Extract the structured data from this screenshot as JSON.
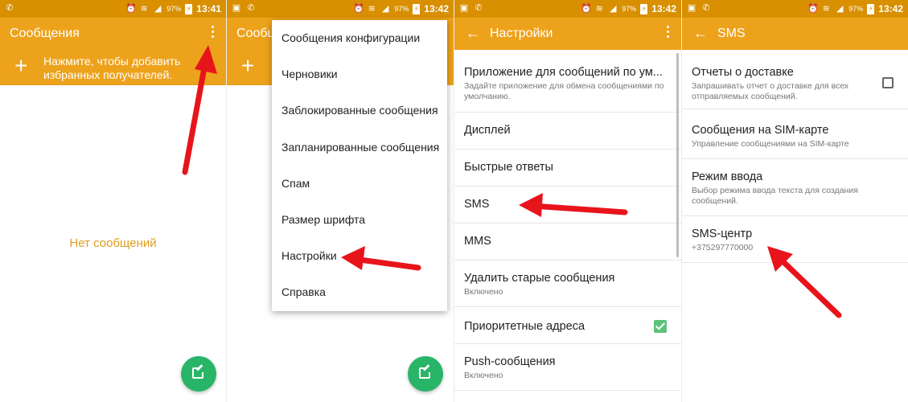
{
  "status": {
    "panel1_time": "13:41",
    "panel2_time": "13:42",
    "panel3_time": "13:42",
    "panel4_time": "13:42",
    "battery": "97%"
  },
  "panel1": {
    "title": "Сообщения",
    "favorites_text": "Нажмите, чтобы добавить избранных получателей.",
    "empty_text": "Нет сообщений"
  },
  "panel2": {
    "title": "Сообщ",
    "menu": [
      {
        "label": "Сообщения конфигурации"
      },
      {
        "label": "Черновики"
      },
      {
        "label": "Заблокированные сообщения"
      },
      {
        "label": "Запланированные сообщения"
      },
      {
        "label": "Спам"
      },
      {
        "label": "Размер шрифта"
      },
      {
        "label": "Настройки"
      },
      {
        "label": "Справка"
      }
    ]
  },
  "panel3": {
    "title": "Настройки",
    "items": [
      {
        "title": "Приложение для сообщений по ум...",
        "subtitle": "Задайте приложение для обмена сообщениями по умолчанию."
      },
      {
        "title": "Дисплей"
      },
      {
        "title": "Быстрые ответы"
      },
      {
        "title": "SMS"
      },
      {
        "title": "MMS"
      },
      {
        "title": "Удалить старые сообщения",
        "subtitle": "Включено"
      },
      {
        "title": "Приоритетные адреса",
        "checked": true
      },
      {
        "title": "Push-сообщения",
        "subtitle": "Включено"
      }
    ]
  },
  "panel4": {
    "title": "SMS",
    "items": [
      {
        "title": "Отчеты о доставке",
        "subtitle": "Запрашивать отчет о доставке для всех отправляемых сообщений.",
        "checked": false
      },
      {
        "title": "Сообщения на SIM-карте",
        "subtitle": "Управление сообщениями на SIM-карте"
      },
      {
        "title": "Режим ввода",
        "subtitle": "Выбор режима ввода текста для создания сообщений."
      },
      {
        "title": "SMS-центр",
        "subtitle": "+375297770000"
      }
    ]
  },
  "colors": {
    "status_bar": "#d88f00",
    "app_bar": "#eda21b",
    "accent_text": "#dfa01e",
    "fab": "#29b568",
    "annotation_arrow": "#e8141b"
  },
  "icons": [
    "phone-icon",
    "whatsapp-icon",
    "alarm-icon",
    "wifi-icon",
    "signal-icon",
    "battery-icon",
    "overflow-menu-icon",
    "plus-icon",
    "back-arrow-icon",
    "compose-icon",
    "annotation-arrow"
  ]
}
